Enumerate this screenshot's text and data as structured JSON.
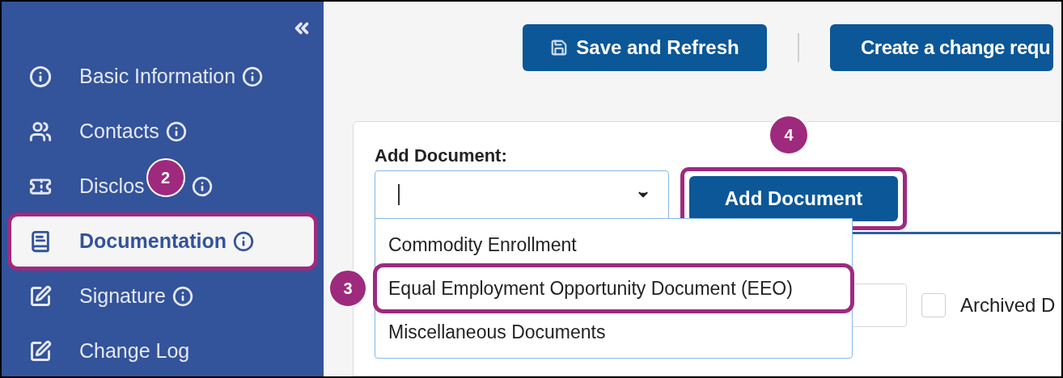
{
  "sidebar": {
    "items": [
      {
        "label": "Basic Information",
        "kind": "info",
        "selected": false,
        "highlighted": false
      },
      {
        "label": "Contacts",
        "kind": "users",
        "selected": false,
        "highlighted": false
      },
      {
        "label": "Disclos",
        "kind": "ticket",
        "selected": false,
        "highlighted": false,
        "callout": "2"
      },
      {
        "label": "Documentation",
        "kind": "book",
        "selected": true,
        "highlighted": true
      },
      {
        "label": "Signature",
        "kind": "edit",
        "selected": false,
        "highlighted": false
      },
      {
        "label": "Change Log",
        "kind": "edit",
        "selected": false,
        "highlighted": false,
        "info": false
      }
    ]
  },
  "toolbar": {
    "buttons": [
      {
        "label": "Save and Refresh",
        "kind": "save"
      },
      {
        "label": "Create a change requ",
        "kind": "plain"
      }
    ]
  },
  "add_document": {
    "label": "Add Document:",
    "button": {
      "label": "Add Document",
      "highlighted": true,
      "callout": "4"
    },
    "menu": [
      {
        "label": "Commodity Enrollment",
        "highlighted": false
      },
      {
        "label": "Equal Employment Opportunity Document (EEO)",
        "highlighted": true,
        "callout": "3"
      },
      {
        "label": "Miscellaneous Documents",
        "highlighted": false
      }
    ],
    "archived": {
      "label": "Archived D",
      "checked": false
    }
  }
}
